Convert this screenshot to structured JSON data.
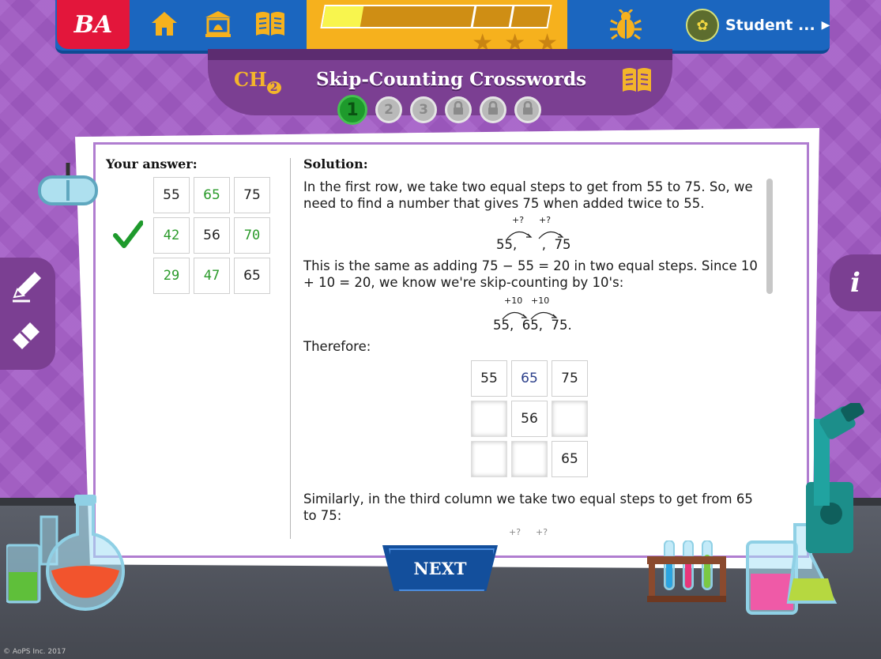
{
  "brand": {
    "logo_text": "BA"
  },
  "nav": {
    "student_label": "Student ...",
    "icons": [
      "home-icon",
      "classroom-icon",
      "book-icon",
      "bug-icon",
      "avatar-icon"
    ]
  },
  "progress": {
    "fill_fraction": 0.17,
    "stars_total": 3,
    "stars_earned": 0
  },
  "chapter": {
    "label": "CH",
    "number": "2",
    "title": "Skip-Counting Crosswords"
  },
  "steps": [
    {
      "label": "1",
      "state": "active"
    },
    {
      "label": "2",
      "state": "available"
    },
    {
      "label": "3",
      "state": "available"
    },
    {
      "label": "",
      "state": "locked"
    },
    {
      "label": "",
      "state": "locked"
    },
    {
      "label": "",
      "state": "locked"
    }
  ],
  "answer": {
    "title": "Your answer:",
    "grid": [
      [
        "55",
        "65",
        "75"
      ],
      [
        "42",
        "56",
        "70"
      ],
      [
        "29",
        "47",
        "65"
      ]
    ],
    "status": "correct"
  },
  "solution": {
    "title": "Solution:",
    "para1": "In the first row, we take two equal steps to get from 55 to 75. So, we need to find a number that gives 75 when added twice to 55.",
    "eq1": {
      "step_labels": [
        "+?",
        "+?"
      ],
      "expr": "55,      ,  75"
    },
    "para2": "This is the same as adding 75 − 55 = 20 in two equal steps. Since 10 + 10 = 20, we know we're skip-counting by 10's:",
    "eq2": {
      "step_labels": [
        "+10",
        "+10"
      ],
      "expr": "55,  65,  75."
    },
    "para3": "Therefore:",
    "grid": [
      [
        "55",
        "65",
        "75"
      ],
      [
        "",
        "56",
        ""
      ],
      [
        "",
        "",
        "65"
      ]
    ],
    "para4": "Similarly, in the third column we take two equal steps to get from 65 to 75:",
    "eq3": {
      "step_labels": [
        "+?",
        "+?"
      ]
    }
  },
  "buttons": {
    "next_label": "NEXT",
    "info_label": "i"
  },
  "footer": {
    "copyright": "© AoPS Inc. 2017"
  },
  "colors": {
    "nav_blue": "#1b66bf",
    "logo_red": "#e3163b",
    "accent_yellow": "#f6b11d",
    "purple": "#7b3f92",
    "correct_green": "#2a9a2a"
  }
}
